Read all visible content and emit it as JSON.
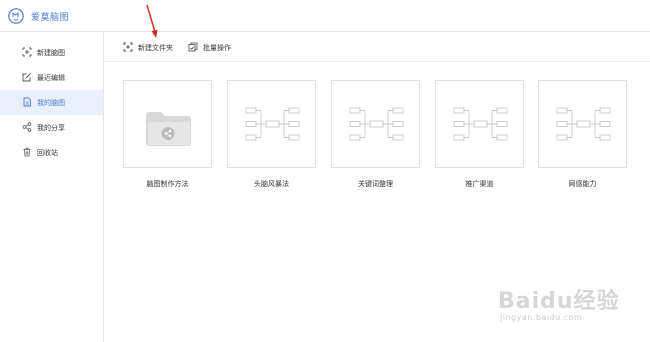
{
  "app": {
    "title": "爱莫脑图"
  },
  "sidebar": {
    "items": [
      {
        "label": "新建脑图",
        "icon": "plus-square-icon",
        "active": false
      },
      {
        "label": "最近编辑",
        "icon": "edit-icon",
        "active": false
      },
      {
        "label": "我的脑图",
        "icon": "document-icon",
        "active": true
      },
      {
        "label": "我的分享",
        "icon": "share-icon",
        "active": false
      },
      {
        "label": "回收站",
        "icon": "trash-icon",
        "active": false
      }
    ]
  },
  "toolbar": {
    "new_folder_label": "新建文件夹",
    "batch_label": "批量操作"
  },
  "cards": [
    {
      "label": "脑图制作方法",
      "type": "folder"
    },
    {
      "label": "头脑风暴法",
      "type": "mindmap"
    },
    {
      "label": "关键词整理",
      "type": "mindmap"
    },
    {
      "label": "推广渠道",
      "type": "mindmap"
    },
    {
      "label": "网感能力",
      "type": "mindmap"
    }
  ],
  "watermark": {
    "brand": "Baidu经验",
    "url": "jingyan.baidu.com"
  },
  "colors": {
    "accent": "#4a7bd0",
    "active_bg": "#e9f0fb",
    "arrow": "#d9261c",
    "card_icon": "#cccccc"
  }
}
